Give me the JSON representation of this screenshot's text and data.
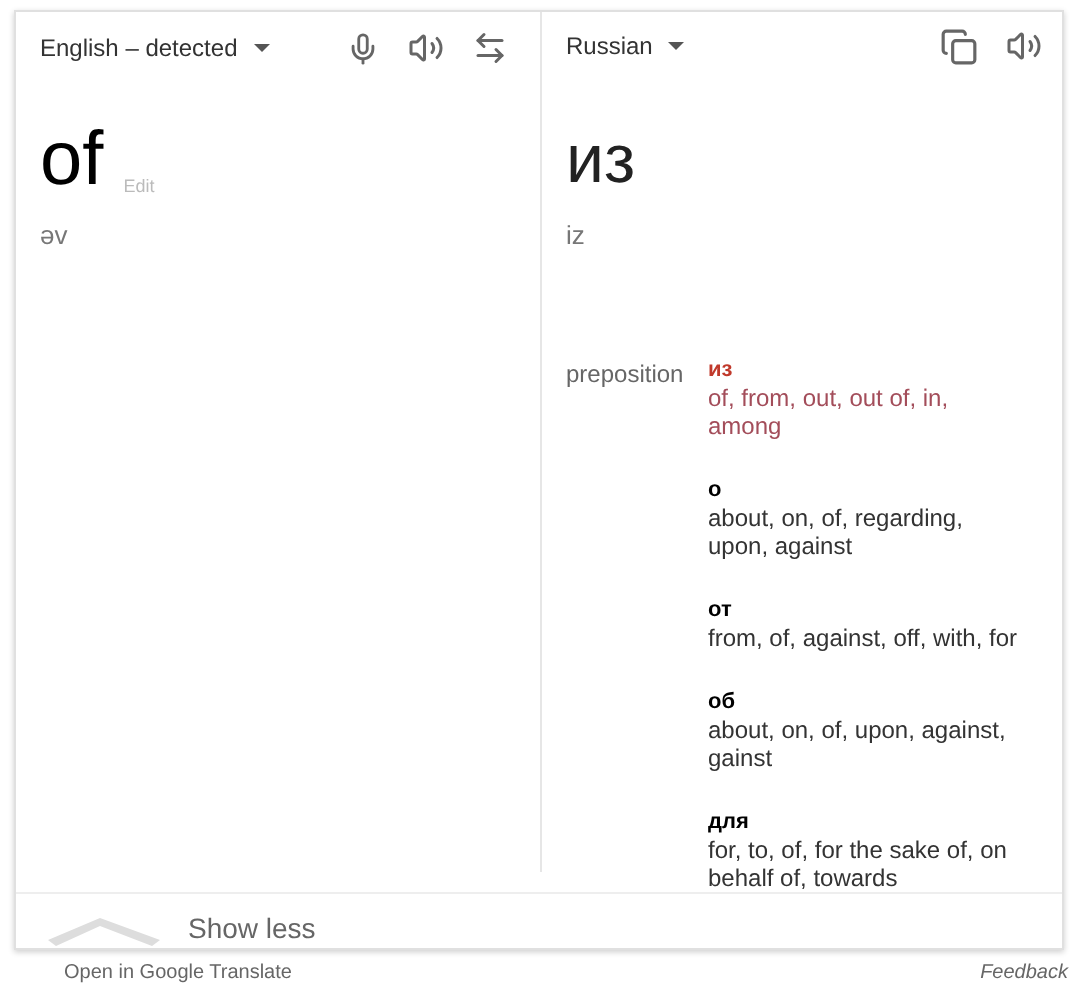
{
  "source": {
    "language": "English – detected",
    "word": "of",
    "edit": "Edit",
    "phonetic": "əv"
  },
  "target": {
    "language": "Russian",
    "word": "из",
    "phonetic": "iz"
  },
  "dictionary": {
    "part_of_speech": "preposition",
    "entries": [
      {
        "word": "из",
        "meanings": "of, from, out, out of, in, among",
        "highlighted": true
      },
      {
        "word": "о",
        "meanings": "about, on, of, regarding, upon, against",
        "highlighted": false
      },
      {
        "word": "от",
        "meanings": "from, of, against, off, with, for",
        "highlighted": false
      },
      {
        "word": "об",
        "meanings": "about, on, of, upon, against, gainst",
        "highlighted": false
      },
      {
        "word": "для",
        "meanings": "for, to, of, for the sake of, on behalf of, towards",
        "highlighted": false
      }
    ]
  },
  "toggle": {
    "label": "Show less"
  },
  "footer": {
    "open_link": "Open in Google Translate",
    "feedback": "Feedback"
  }
}
